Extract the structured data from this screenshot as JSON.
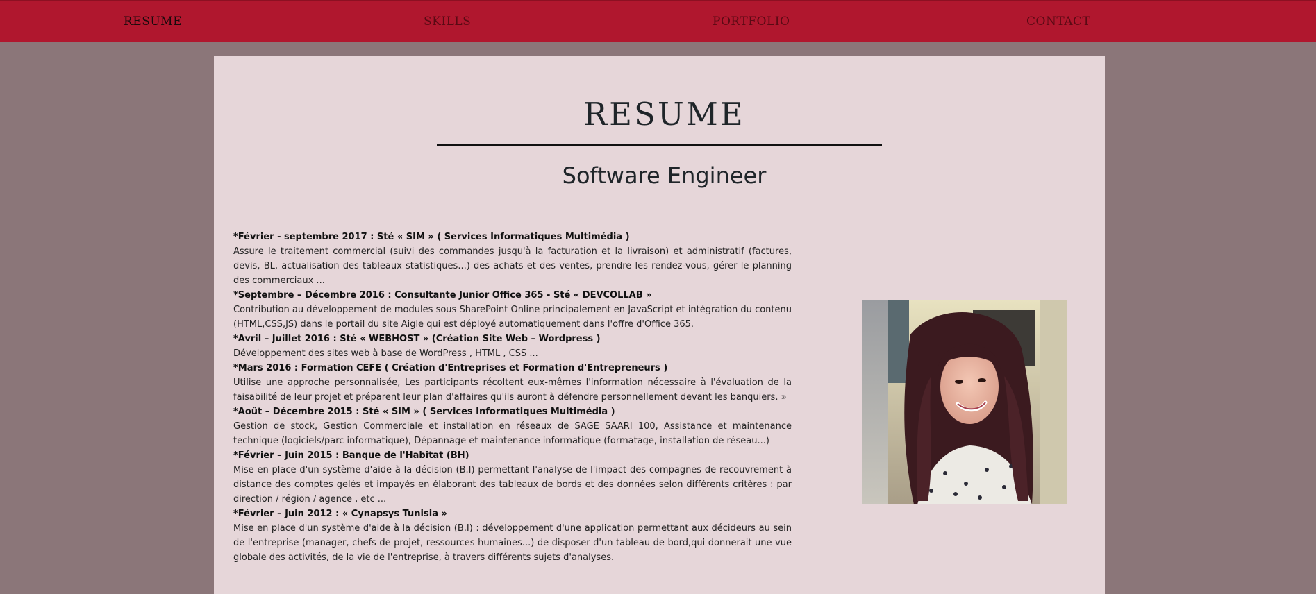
{
  "nav": {
    "items": [
      {
        "label": "RESUME"
      },
      {
        "label": "SKILLS"
      },
      {
        "label": "PORTFOLIO"
      },
      {
        "label": "CONTACT"
      }
    ]
  },
  "page": {
    "title": "RESUME",
    "subtitle": "Software Engineer"
  },
  "experience": [
    {
      "heading": "*Février - septembre 2017 : Sté « SIM » ( Services Informatiques Multimédia )",
      "description": "Assure le traitement commercial (suivi des commandes jusqu'à la facturation et la livraison) et administratif (factures, devis, BL, actualisation des tableaux statistiques...) des achats et des ventes, prendre les rendez-vous, gérer le planning des commerciaux ..."
    },
    {
      "heading": "*Septembre – Décembre 2016 : Consultante Junior Office 365 - Sté « DEVCOLLAB »",
      "description": "Contribution au développement de modules sous SharePoint Online principalement en JavaScript et intégration du contenu (HTML,CSS,JS) dans le portail du site Aigle qui est déployé automatiquement dans l'offre d'Office 365."
    },
    {
      "heading": "*Avril – Juillet 2016 : Sté « WEBHOST » (Création Site Web – Wordpress )",
      "description": "Développement des sites web à base de WordPress , HTML , CSS ..."
    },
    {
      "heading": "*Mars 2016 : Formation CEFE ( Création d'Entreprises et Formation d'Entrepreneurs )",
      "description": "Utilise une approche personnalisée, Les participants récoltent eux-mêmes l'information nécessaire à l'évaluation de la faisabilité de leur projet et préparent leur plan d'affaires qu'ils auront à défendre personnellement devant les banquiers. »"
    },
    {
      "heading": "*Août – Décembre 2015 : Sté « SIM » ( Services Informatiques Multimédia )",
      "description": "Gestion de stock, Gestion Commerciale et installation en réseaux de SAGE SAARI 100, Assistance et maintenance technique (logiciels/parc informatique), Dépannage et maintenance informatique (formatage, installation de réseau...)"
    },
    {
      "heading": "*Février – Juin 2015 : Banque de l'Habitat (BH)",
      "description": "Mise en place d'un système d'aide à la décision (B.I) permettant l'analyse de l'impact des compagnes de recouvrement à distance des comptes gelés et impayés en élaborant des tableaux de bords et des données selon différents critères : par direction / région / agence , etc ..."
    },
    {
      "heading": "*Février – Juin 2012 : « Cynapsys Tunisia »",
      "description": "Mise en place d'un système d'aide à la décision (B.I) : développement d'une application permettant aux décideurs au sein de l'entreprise (manager, chefs de projet, ressources humaines...) de disposer d'un tableau de bord,qui donnerait une vue globale des activités, de la vie de l'entreprise, à travers différents sujets d'analyses."
    }
  ],
  "colors": {
    "navbar": "#b0172e",
    "background": "#8b7679",
    "card": "#e6d6d9"
  }
}
